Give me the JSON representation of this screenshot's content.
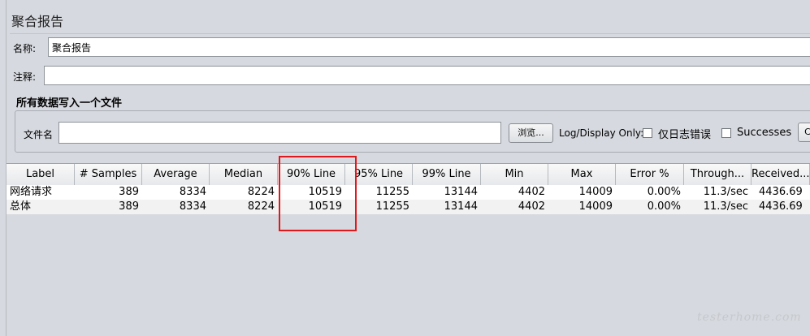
{
  "panel": {
    "title": "聚合报告"
  },
  "name_field": {
    "label": "名称:",
    "value": "聚合报告"
  },
  "comment_field": {
    "label": "注释:",
    "value": ""
  },
  "file_group": {
    "title": "所有数据写入一个文件",
    "filename_label": "文件名",
    "filename_value": "",
    "browse_label": "浏览...",
    "log_display_label": "Log/Display Only:",
    "errors_only_label": "仅日志错误",
    "successes_label": "Successes",
    "cut_button_label": "C"
  },
  "table": {
    "headers": [
      "Label",
      "# Samples",
      "Average",
      "Median",
      "90% Line",
      "95% Line",
      "99% Line",
      "Min",
      "Max",
      "Error %",
      "Through...",
      "Received..."
    ],
    "rows": [
      [
        "网络请求",
        "389",
        "8334",
        "8224",
        "10519",
        "11255",
        "13144",
        "4402",
        "14009",
        "0.00%",
        "11.3/sec",
        "4436.69"
      ],
      [
        "总体",
        "389",
        "8334",
        "8224",
        "10519",
        "11255",
        "13144",
        "4402",
        "14009",
        "0.00%",
        "11.3/sec",
        "4436.69"
      ]
    ]
  },
  "highlight_color": "#e0181c",
  "watermark": "testerhome.com"
}
